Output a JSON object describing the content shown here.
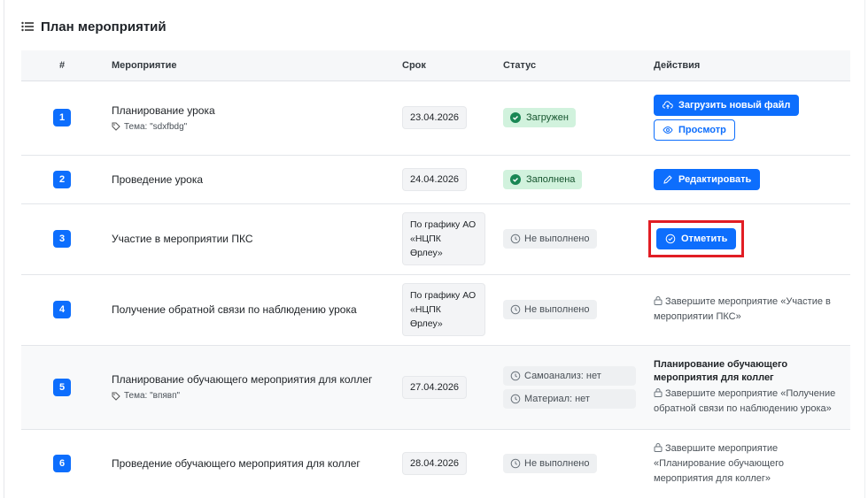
{
  "page": {
    "title": "План мероприятий"
  },
  "table": {
    "headers": {
      "num": "#",
      "event": "Мероприятие",
      "deadline": "Срок",
      "status": "Статус",
      "actions": "Действия"
    }
  },
  "rows": [
    {
      "num": "1",
      "title": "Планирование урока",
      "topic": "Тема: \"sdxfbdg\"",
      "deadline": "23.04.2026",
      "status": "Загружен",
      "btn_upload": "Загрузить новый файл",
      "btn_view": "Просмотр"
    },
    {
      "num": "2",
      "title": "Проведение урока",
      "deadline": "24.04.2026",
      "status": "Заполнена",
      "btn_edit": "Редактировать"
    },
    {
      "num": "3",
      "title": "Участие в мероприятии ПКС",
      "deadline_lines": [
        "По графику АО",
        "«НЦПК",
        "Өрлеу»"
      ],
      "status": "Не выполнено",
      "btn_mark": "Отметить"
    },
    {
      "num": "4",
      "title": "Получение обратной связи по наблюдению урока",
      "deadline_lines": [
        "По графику АО",
        "«НЦПК",
        "Өрлеу»"
      ],
      "status": "Не выполнено",
      "locked_lines": [
        "Завершите мероприятие «Участие в",
        "мероприятии ПКС»"
      ]
    },
    {
      "num": "5",
      "title": "Планирование обучающего мероприятия для коллег",
      "topic": "Тема: \"впявп\"",
      "deadline": "27.04.2026",
      "status_self": "Самоанализ: нет",
      "status_material": "Материал: нет",
      "note_lines": [
        "Планирование обучающего",
        "мероприятия для коллег"
      ],
      "locked_lines": [
        "Завершите мероприятие «Получение",
        "обратной связи по наблюдению урока»"
      ]
    },
    {
      "num": "6",
      "title": "Проведение обучающего мероприятия для коллег",
      "deadline": "28.04.2026",
      "status": "Не выполнено",
      "locked_lines": [
        "Завершите мероприятие",
        "«Планирование обучающего",
        "мероприятия для коллег»"
      ]
    }
  ],
  "icons": {
    "header": "list-icon",
    "topic": "tag-icon",
    "status_ok": "check-circle-icon",
    "status_pending": "clock-icon",
    "upload": "cloud-upload-icon",
    "view": "eye-icon",
    "edit": "pencil-icon",
    "mark": "check-circle-icon",
    "locked": "lock-icon"
  },
  "colors": {
    "primary": "#0d6efd",
    "success_bg": "#d1f2dd",
    "success": "#198754",
    "highlight": "#e11d24"
  }
}
